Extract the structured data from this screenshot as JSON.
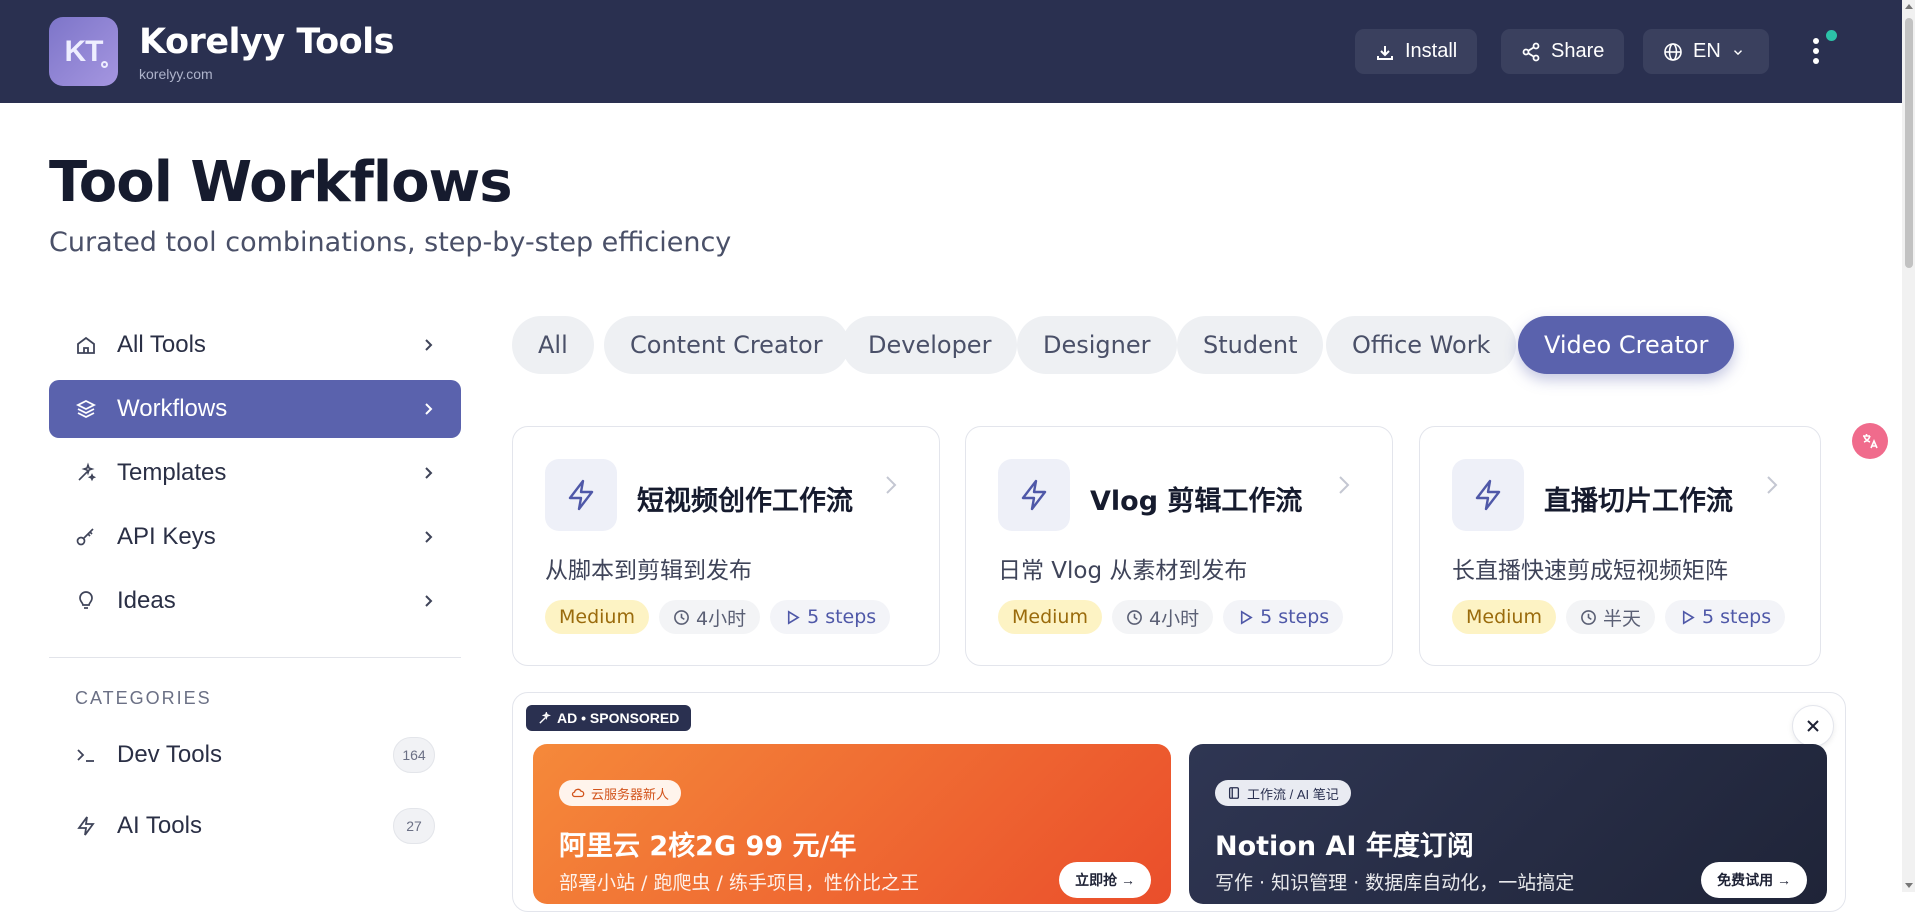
{
  "header": {
    "logo_text": "KT",
    "brand_title": "Korelyy Tools",
    "brand_domain": "korelyy.com",
    "install_label": "Install",
    "share_label": "Share",
    "language_label": "EN",
    "accent_color": "#2a3050"
  },
  "page": {
    "title": "Tool Workflows",
    "subtitle": "Curated tool combinations, step-by-step efficiency"
  },
  "sidebar": {
    "items": [
      {
        "label": "All Tools",
        "icon": "home-icon"
      },
      {
        "label": "Workflows",
        "icon": "layers-icon",
        "active": true
      },
      {
        "label": "Templates",
        "icon": "sparkles-icon"
      },
      {
        "label": "API Keys",
        "icon": "key-icon"
      },
      {
        "label": "Ideas",
        "icon": "lightbulb-icon"
      }
    ],
    "categories_heading": "CATEGORIES",
    "categories": [
      {
        "label": "Dev Tools",
        "count": "164",
        "icon": "terminal-icon"
      },
      {
        "label": "AI Tools",
        "count": "27",
        "icon": "lightning-icon"
      }
    ]
  },
  "filters": {
    "chips": [
      "All",
      "Content Creator",
      "Developer",
      "Designer",
      "Student",
      "Office Work",
      "Video Creator"
    ],
    "selected": "Video Creator"
  },
  "workflows": [
    {
      "title": "短视频创作工作流",
      "description": "从脚本到剪辑到发布",
      "difficulty": "Medium",
      "duration": "4小时",
      "steps": "5 steps"
    },
    {
      "title": "Vlog 剪辑工作流",
      "description": "日常 Vlog 从素材到发布",
      "difficulty": "Medium",
      "duration": "4小时",
      "steps": "5 steps"
    },
    {
      "title": "直播切片工作流",
      "description": "长直播快速剪成短视频矩阵",
      "difficulty": "Medium",
      "duration": "半天",
      "steps": "5 steps"
    }
  ],
  "ad": {
    "badge": "AD • SPONSORED",
    "cards": [
      {
        "tag": "云服务器新人",
        "title": "阿里云 2核2G 99 元/年",
        "description": "部署小站 / 跑爬虫 / 练手项目，性价比之王",
        "cta": "立即抢 →"
      },
      {
        "tag": "工作流 / AI 笔记",
        "title": "Notion AI 年度订阅",
        "description": "写作 · 知识管理 · 数据库自动化，一站搞定",
        "cta": "免费试用 →"
      }
    ]
  },
  "colors": {
    "primary": "#5a62ad",
    "difficulty_bg": "#fdf3c4",
    "online_dot": "#2cc2a8"
  }
}
